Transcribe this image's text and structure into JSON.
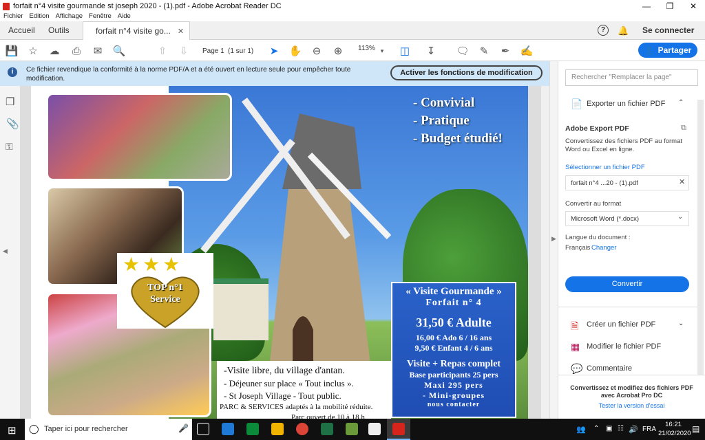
{
  "window": {
    "title": "forfait n°4 visite gourmande   st joseph 2020 - (1).pdf - Adobe Acrobat Reader DC"
  },
  "menubar": [
    "Fichier",
    "Edition",
    "Affichage",
    "Fenêtre",
    "Aide"
  ],
  "tabs": {
    "home": "Accueil",
    "tools": "Outils",
    "doc": "forfait n°4 visite go...",
    "sign_in": "Se connecter"
  },
  "toolbar": {
    "page_label": "Page 1",
    "page_of": "(1 sur 1)",
    "zoom": "113%",
    "share": "Partager"
  },
  "info": {
    "message": "Ce fichier revendique la conformité à la norme PDF/A et a été ouvert en lecture seule pour empêcher toute modification.",
    "enable_button": "Activer les fonctions de modification"
  },
  "pdf": {
    "slogans": [
      "- Convivial",
      "- Pratique",
      "- Budget étudié!"
    ],
    "badge": {
      "line1": "TOP n°1",
      "line2": "Service"
    },
    "offer": {
      "title": "« Visite Gourmande »",
      "forfait": "Forfait n° 4",
      "price": "31,50 € Adulte",
      "ado": "16,00 €  Ado  6 / 16 ans",
      "enfant": "9,50 €  Enfant 4 / 6 ans",
      "visite": "Visite + Repas complet",
      "base": "Base participants  25 pers",
      "maxi": "Maxi  295 pers",
      "mini": "- Mini-groupes",
      "contact": "nous contacter"
    },
    "bottom_lines": [
      "-Visite libre, du village d'antan.",
      "- Déjeuner sur place « Tout inclus ».",
      "- St Joseph Village - Tout public."
    ],
    "services": "PARC & SERVICES adaptés à la mobilité réduite.",
    "hours": "Parc ouvert de 10 à 18 h"
  },
  "panel": {
    "search_placeholder": "Rechercher \"Remplacer la page\"",
    "export_label": "Exporter un fichier PDF",
    "adobe_export": "Adobe Export PDF",
    "export_desc": "Convertissez des fichiers PDF au format Word ou Excel en ligne.",
    "select_file": "Sélectionner un fichier PDF",
    "file_name": "forfait n°4 ...20 - (1).pdf",
    "convert_to": "Convertir au format",
    "format": "Microsoft Word (*.docx)",
    "doc_lang_label": "Langue du document :",
    "lang": "Français",
    "change": "Changer",
    "convert_btn": "Convertir",
    "create_pdf": "Créer un fichier PDF",
    "edit_pdf": "Modifier le fichier PDF",
    "comment": "Commentaire",
    "promo": "Convertissez et modifiez des fichiers PDF avec Acrobat Pro DC",
    "trial": "Tester la version d'essai"
  },
  "taskbar": {
    "search_placeholder": "Taper ici pour rechercher",
    "lang": "FRA",
    "time": "16:21",
    "date": "21/02/2020"
  },
  "colors": {
    "accent": "#1473e6",
    "info_bg": "#cfe6f8",
    "offer_bg": "#2a62c9"
  }
}
